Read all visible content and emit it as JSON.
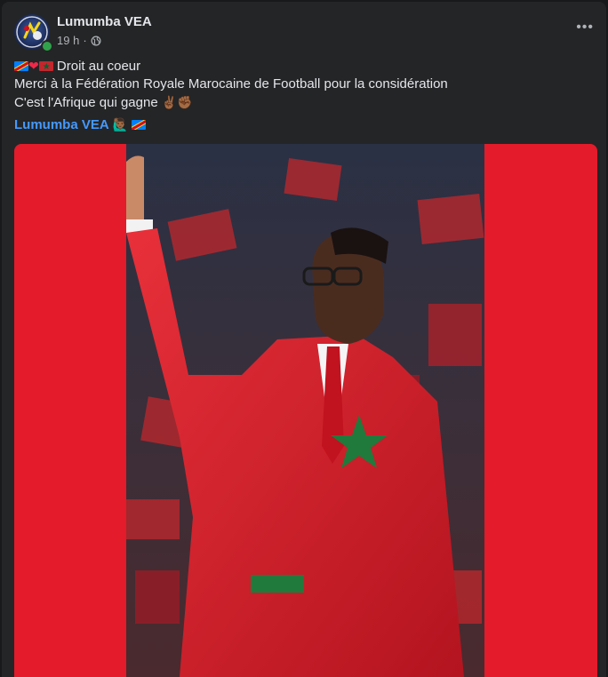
{
  "post": {
    "author": "Lumumba VEA",
    "time": "19 h",
    "separator": "·",
    "privacy_icon": "globe-icon",
    "more_label": "•••",
    "line1_text": "Droit au coeur",
    "line2_text": "Merci à la Fédération Royale Marocaine de Football pour la considération",
    "line3_text": "C'est l'Afrique qui gagne",
    "line3_emojis": "✌🏾✊🏾",
    "mention_name": "Lumumba VEA",
    "mention_emoji": "🙋🏾‍♂️",
    "flag_icons": [
      "dr-congo-flag-icon",
      "heart-icon",
      "morocco-flag-icon"
    ],
    "image_description_colors": {
      "frame": "#e31b2a",
      "suit": "#e0232e",
      "star": "#1f7a3b"
    }
  },
  "theme": {
    "background": "#18191a",
    "card": "#242526",
    "text": "#e4e6eb",
    "muted": "#b0b3b8",
    "link": "#4599ff",
    "online": "#31a24c"
  }
}
